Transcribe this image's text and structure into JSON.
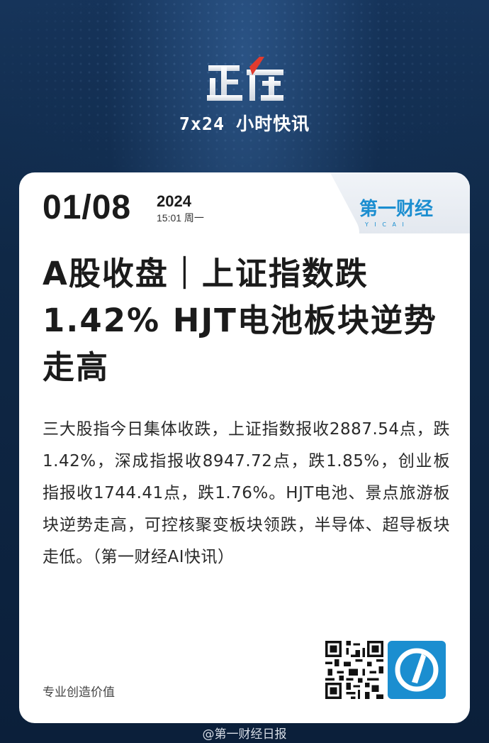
{
  "header": {
    "logo_text": "正在",
    "subtitle": "7x24 小时快讯"
  },
  "card": {
    "date": "01/08",
    "year": "2024",
    "time_weekday": "15:01 周一",
    "source_logo_text": "第一财经",
    "source_logo_sub": "Y I C A I",
    "headline": "A股收盘｜上证指数跌1.42%  HJT电池板块逆势走高",
    "body": "三大股指今日集体收跌，上证指数报收2887.54点，跌1.42%，深成指报收8947.72点，跌1.85%，创业板指报收1744.41点，跌1.76%。HJT电池、景点旅游板块逆势走高，可控核聚变板块领跌，半导体、超导板块走低。（第一财经AI快讯）",
    "slogan": "专业创造价值"
  },
  "watermark": "@第一财经日报",
  "colors": {
    "background": "#0d2340",
    "accent_red": "#e23b2e",
    "brand_blue": "#1b8ed0",
    "card": "#ffffff"
  },
  "icons": {
    "qr": "qr-code-icon",
    "app": "yicai-app-icon",
    "weibo": "weibo-icon"
  }
}
